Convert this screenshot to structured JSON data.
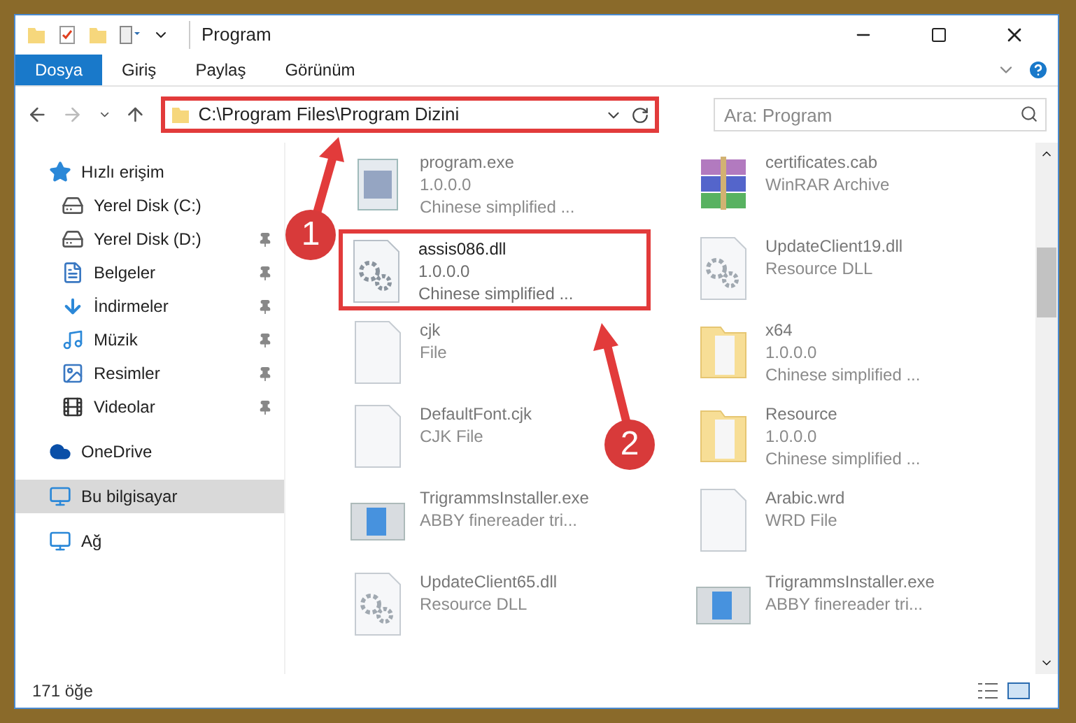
{
  "window": {
    "title": "Program"
  },
  "ribbon_tabs": [
    {
      "label": "Dosya",
      "selected": true
    },
    {
      "label": "Giriş",
      "selected": false
    },
    {
      "label": "Paylaş",
      "selected": false
    },
    {
      "label": "Görünüm",
      "selected": false
    }
  ],
  "address": {
    "path": "C:\\Program Files\\Program Dizini",
    "highlighted": true
  },
  "search": {
    "placeholder": "Ara: Program"
  },
  "sidebar": {
    "items": [
      {
        "label": "Hızlı erişim",
        "kind": "group",
        "pinned": false,
        "selected": false
      },
      {
        "label": "Yerel Disk (C:)",
        "kind": "place",
        "pinned": false,
        "selected": false
      },
      {
        "label": "Yerel Disk (D:)",
        "kind": "place",
        "pinned": true,
        "selected": false
      },
      {
        "label": "Belgeler",
        "kind": "place",
        "pinned": true,
        "selected": false
      },
      {
        "label": "İndirmeler",
        "kind": "place",
        "pinned": true,
        "selected": false
      },
      {
        "label": "Müzik",
        "kind": "place",
        "pinned": true,
        "selected": false
      },
      {
        "label": "Resimler",
        "kind": "place",
        "pinned": true,
        "selected": false
      },
      {
        "label": "Videolar",
        "kind": "place",
        "pinned": true,
        "selected": false
      },
      {
        "label": "OneDrive",
        "kind": "group",
        "pinned": false,
        "selected": false
      },
      {
        "label": "Bu bilgisayar",
        "kind": "group",
        "pinned": false,
        "selected": true
      },
      {
        "label": "Ağ",
        "kind": "group",
        "pinned": false,
        "selected": false
      }
    ]
  },
  "files": [
    {
      "name": "program.exe",
      "lines": [
        "1.0.0.0",
        "Chinese simplified ..."
      ],
      "kind": "exe",
      "highlighted": false
    },
    {
      "name": "certificates.cab",
      "lines": [
        "WinRAR Archive"
      ],
      "kind": "archive",
      "highlighted": false
    },
    {
      "name": "assis086.dll",
      "lines": [
        "1.0.0.0",
        "Chinese simplified ..."
      ],
      "kind": "dll",
      "highlighted": true
    },
    {
      "name": "UpdateClient19.dll",
      "lines": [
        "Resource DLL"
      ],
      "kind": "dll",
      "highlighted": false
    },
    {
      "name": "cjk",
      "lines": [
        "File"
      ],
      "kind": "file",
      "highlighted": false
    },
    {
      "name": "x64",
      "lines": [
        "1.0.0.0",
        "Chinese simplified ..."
      ],
      "kind": "folder",
      "highlighted": false
    },
    {
      "name": "DefaultFont.cjk",
      "lines": [
        "CJK File"
      ],
      "kind": "file",
      "highlighted": false
    },
    {
      "name": "Resource",
      "lines": [
        "1.0.0.0",
        "Chinese simplified ..."
      ],
      "kind": "folder",
      "highlighted": false
    },
    {
      "name": "TrigrammsInstaller.exe",
      "lines": [
        "ABBY finereader tri..."
      ],
      "kind": "installer",
      "highlighted": false
    },
    {
      "name": "Arabic.wrd",
      "lines": [
        "WRD File"
      ],
      "kind": "file",
      "highlighted": false
    },
    {
      "name": "UpdateClient65.dll",
      "lines": [
        "Resource DLL"
      ],
      "kind": "dll",
      "highlighted": false
    },
    {
      "name": "TrigrammsInstaller.exe",
      "lines": [
        "ABBY finereader tri..."
      ],
      "kind": "installer",
      "highlighted": false
    }
  ],
  "status_bar": {
    "count": "171 öğe"
  },
  "annotations": [
    {
      "label": "1"
    },
    {
      "label": "2"
    }
  ]
}
